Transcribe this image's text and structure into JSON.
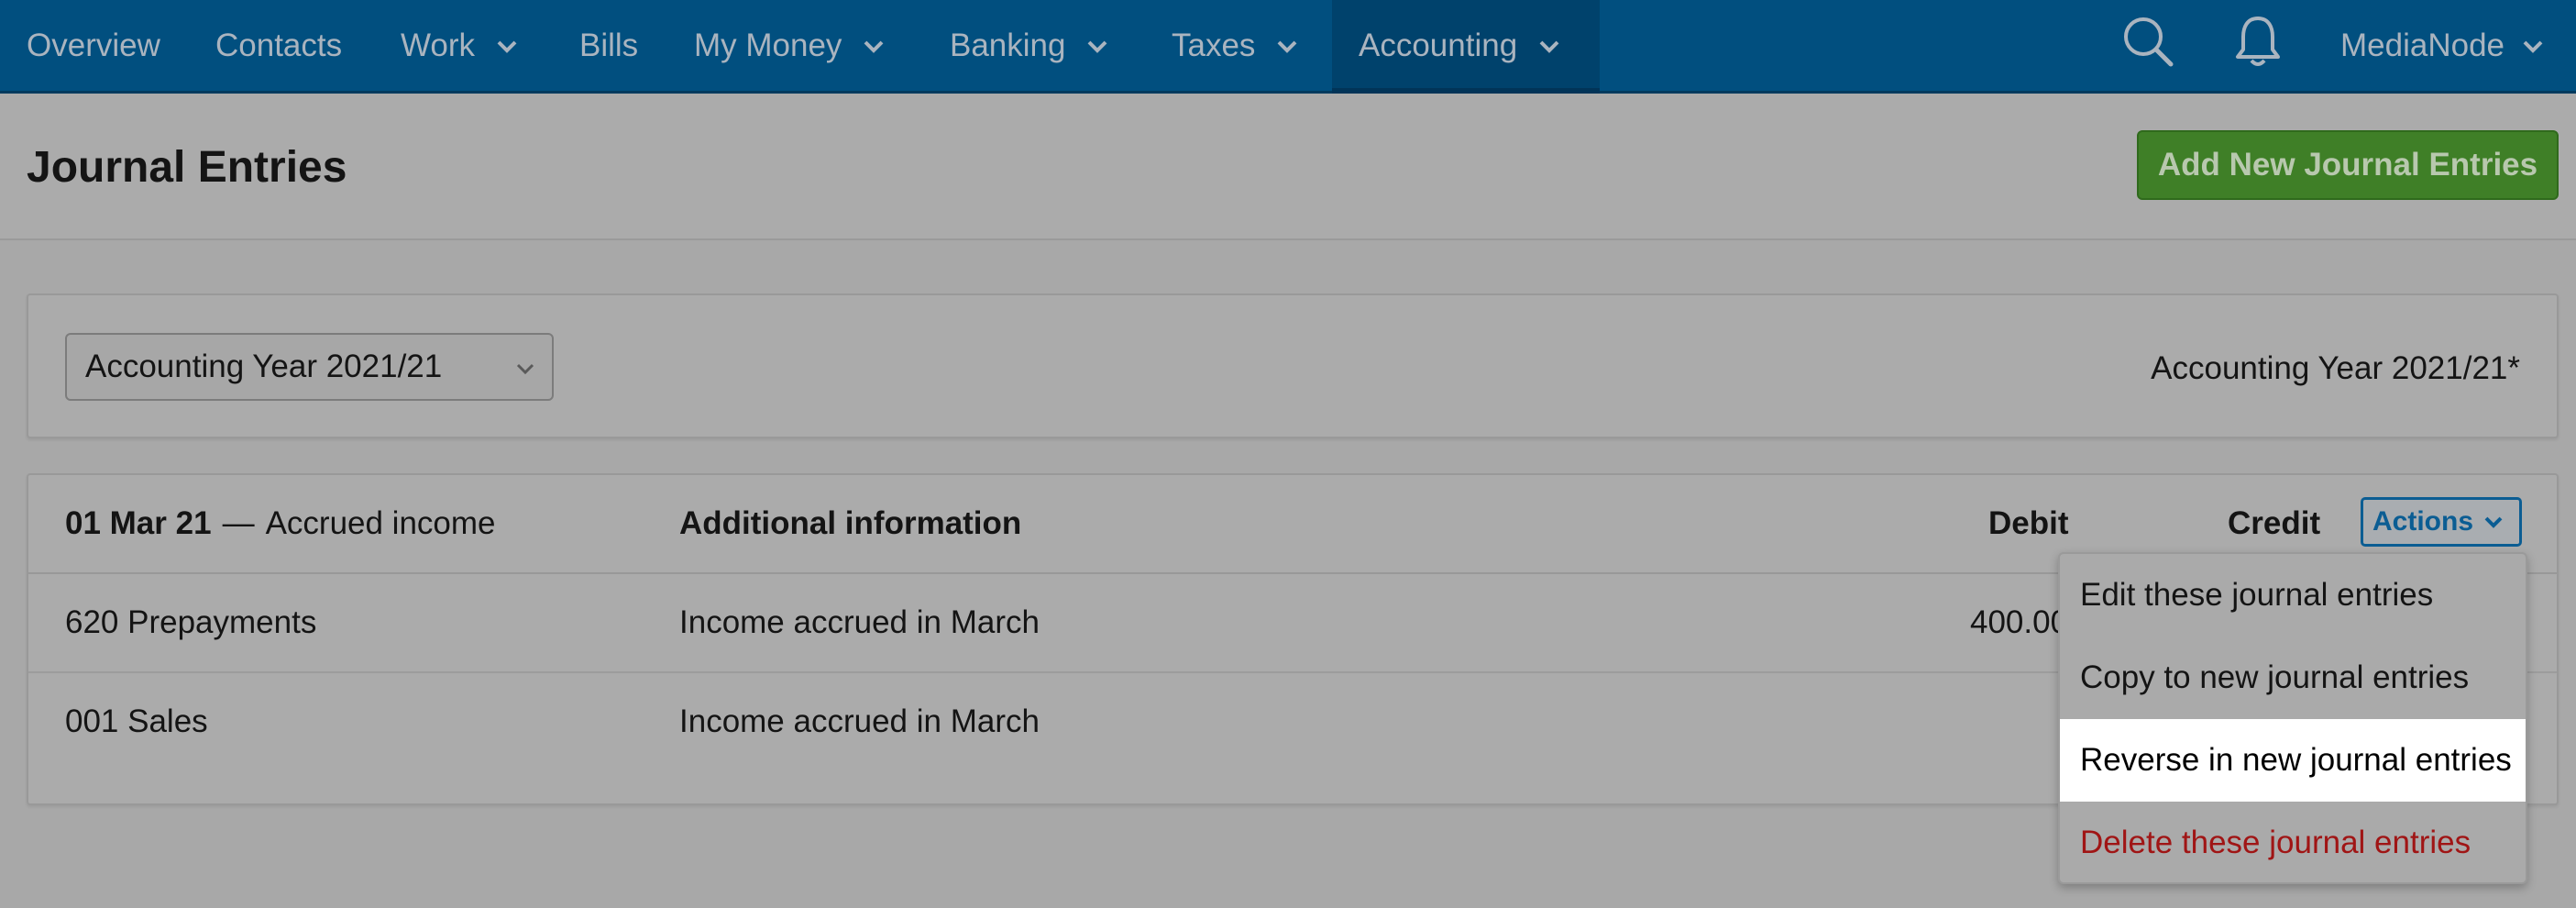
{
  "nav": {
    "items": [
      {
        "label": "Overview"
      },
      {
        "label": "Contacts"
      },
      {
        "label": "Work"
      },
      {
        "label": "Bills"
      },
      {
        "label": "My Money"
      },
      {
        "label": "Banking"
      },
      {
        "label": "Taxes"
      },
      {
        "label": "Accounting"
      }
    ],
    "active": "Accounting",
    "account_label": "MediaNode",
    "icons": [
      "search-icon",
      "bell-icon"
    ]
  },
  "header": {
    "title": "Journal Entries",
    "add_button_label": "Add New Journal Entries"
  },
  "filter": {
    "selected_year": "Accounting Year 2021/21",
    "year_label": "Accounting Year 2021/21*"
  },
  "journal": {
    "date": "01 Mar 21",
    "separator": "—",
    "description": "Accrued income",
    "columns": {
      "additional_info": "Additional information",
      "debit": "Debit",
      "credit": "Credit"
    },
    "actions_label": "Actions",
    "rows": [
      {
        "account": "620 Prepayments",
        "info": "Income accrued in March",
        "debit": "400.00",
        "credit": ""
      },
      {
        "account": "001 Sales",
        "info": "Income accrued in March",
        "debit": "",
        "credit": ""
      }
    ]
  },
  "actions_menu": {
    "items": [
      {
        "label": "Edit these journal entries"
      },
      {
        "label": "Copy to new journal entries"
      },
      {
        "label": "Reverse in new journal entries"
      },
      {
        "label": "Delete these journal entries"
      }
    ],
    "highlighted": "Reverse in new journal entries"
  },
  "colors": {
    "nav_bg": "#014f7f",
    "primary_button": "#3f7f27",
    "danger_text": "#a01515",
    "accent": "#0b5d93"
  }
}
